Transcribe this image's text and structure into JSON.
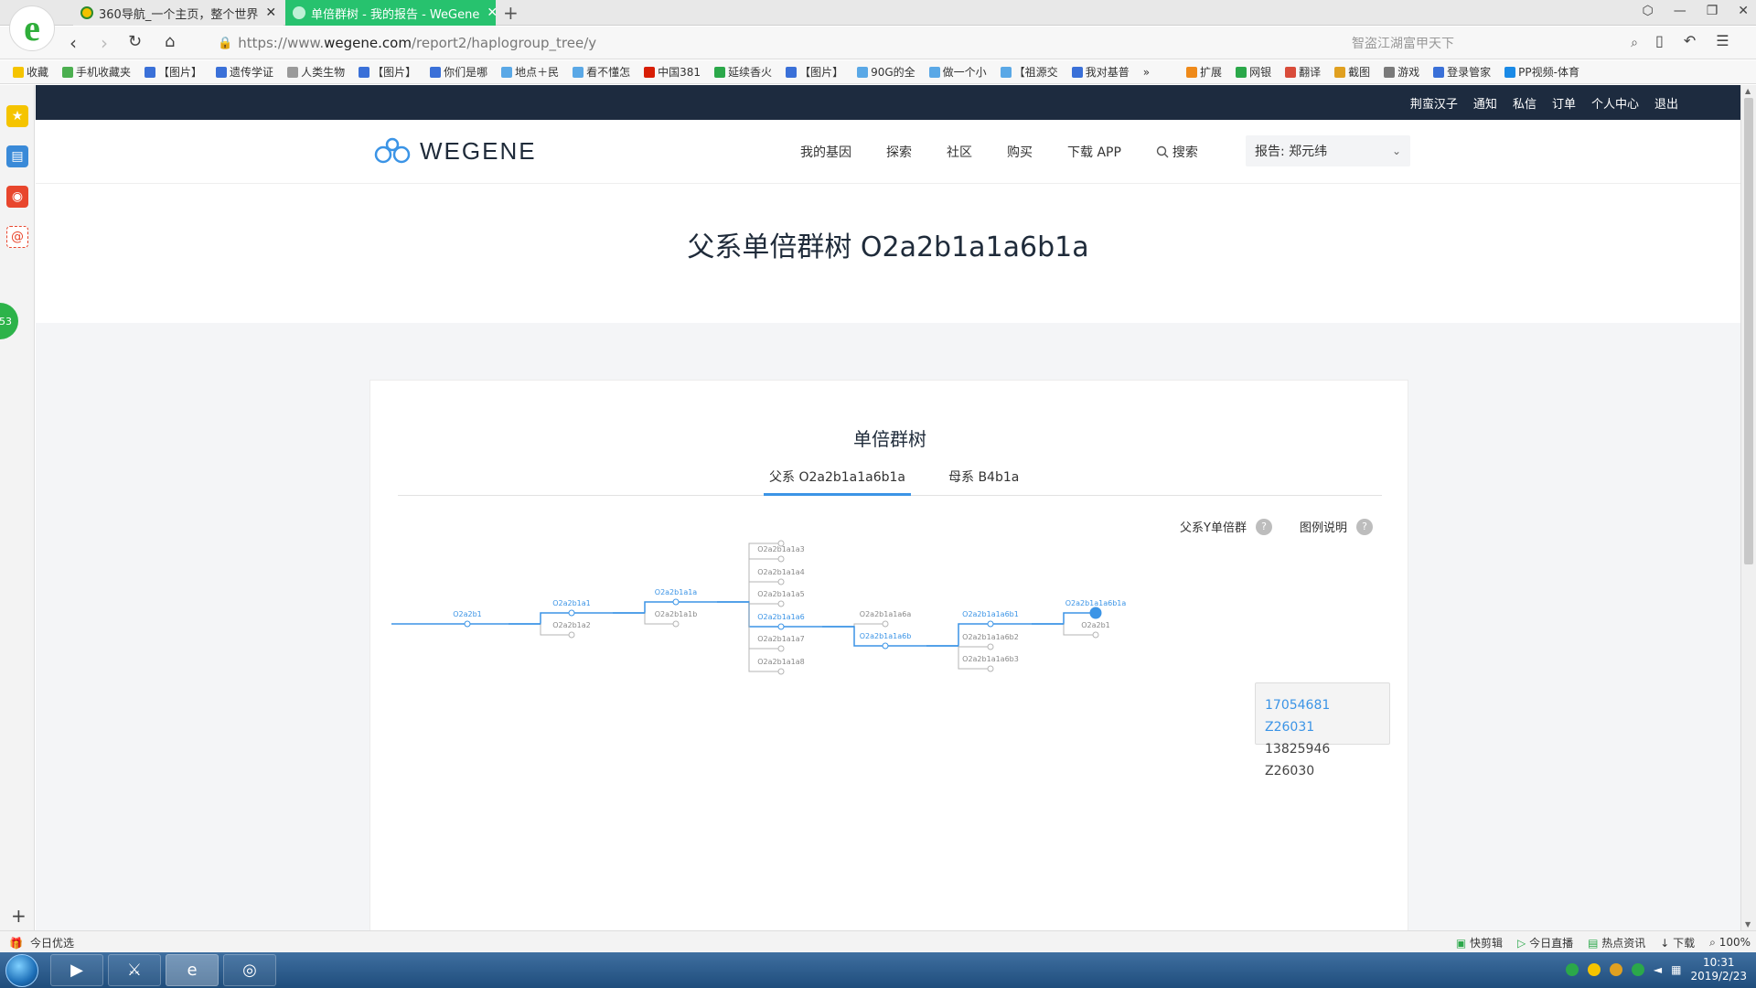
{
  "browser": {
    "tabs": [
      {
        "title": "360导航_一个主页，整个世界",
        "active": false
      },
      {
        "title": "单倍群树 - 我的报告 - WeGene",
        "active": true
      }
    ],
    "url_prefix": "https://www.",
    "url_domain": "wegene.com",
    "url_path": "/report2/haplogroup_tree/y",
    "search_placeholder": "智盗江湖富甲天下",
    "bookmarks": [
      "收藏",
      "手机收藏夹",
      "【图片】",
      "遗传学证",
      "人类生物",
      "【图片】",
      "你们是哪",
      "地点＋民",
      "看不懂怎",
      "中国381",
      "延续香火",
      "【图片】",
      "90G的全",
      "做一个小",
      "【祖源交",
      "我对基普",
      "»",
      "扩展",
      "网银",
      "翻译",
      "截图",
      "游戏",
      "登录管家",
      "PP视频-体育"
    ],
    "side_badge": "53"
  },
  "status": {
    "left": "今日优选",
    "items": [
      "快剪辑",
      "今日直播",
      "热点资讯",
      "下载",
      "100%"
    ]
  },
  "taskbar": {
    "time": "10:31",
    "date": "2019/2/23"
  },
  "site": {
    "toplinks": [
      "荆蛮汉子",
      "通知",
      "私信",
      "订单",
      "个人中心",
      "退出"
    ],
    "logo": "WEGENE",
    "nav": [
      "我的基因",
      "探索",
      "社区",
      "购买",
      "下载 APP"
    ],
    "search_label": "搜索",
    "report_select": "报告: 郑元纬"
  },
  "page": {
    "title": "父系单倍群树 O2a2b1a1a6b1a",
    "card_title": "单倍群树",
    "tab_y": "父系 O2a2b1a1a6b1a",
    "tab_mt": "母系 B4b1a",
    "legend_y": "父系Y单倍群",
    "legend_help": "图例说明",
    "tooltip_line1": "17054681 Z26031",
    "tooltip_line2": "13825946 Z26030"
  },
  "tree": {
    "colors": {
      "path": "#3b94e6",
      "other": "#b5b5b5",
      "label_other": "#888888"
    },
    "nodes": [
      {
        "label": "O2a2b1",
        "on_path": true
      },
      {
        "label": "O2a2b1a1",
        "on_path": true
      },
      {
        "label": "O2a2b1a2",
        "on_path": false
      },
      {
        "label": "O2a2b1a1a",
        "on_path": true
      },
      {
        "label": "O2a2b1a1b",
        "on_path": false
      },
      {
        "label": "O2a2b1a1a3",
        "on_path": false
      },
      {
        "label": "O2a2b1a1a4",
        "on_path": false
      },
      {
        "label": "O2a2b1a1a5",
        "on_path": false
      },
      {
        "label": "O2a2b1a1a6",
        "on_path": true
      },
      {
        "label": "O2a2b1a1a7",
        "on_path": false
      },
      {
        "label": "O2a2b1a1a8",
        "on_path": false
      },
      {
        "label": "O2a2b1a1a6a",
        "on_path": false
      },
      {
        "label": "O2a2b1a1a6b",
        "on_path": true
      },
      {
        "label": "O2a2b1a1a6b1",
        "on_path": true
      },
      {
        "label": "O2a2b1a1a6b2",
        "on_path": false
      },
      {
        "label": "O2a2b1a1a6b3",
        "on_path": false
      },
      {
        "label": "O2a2b1a1a6b1a",
        "on_path": true
      },
      {
        "label": "O2a2b1",
        "on_path": false
      }
    ]
  }
}
